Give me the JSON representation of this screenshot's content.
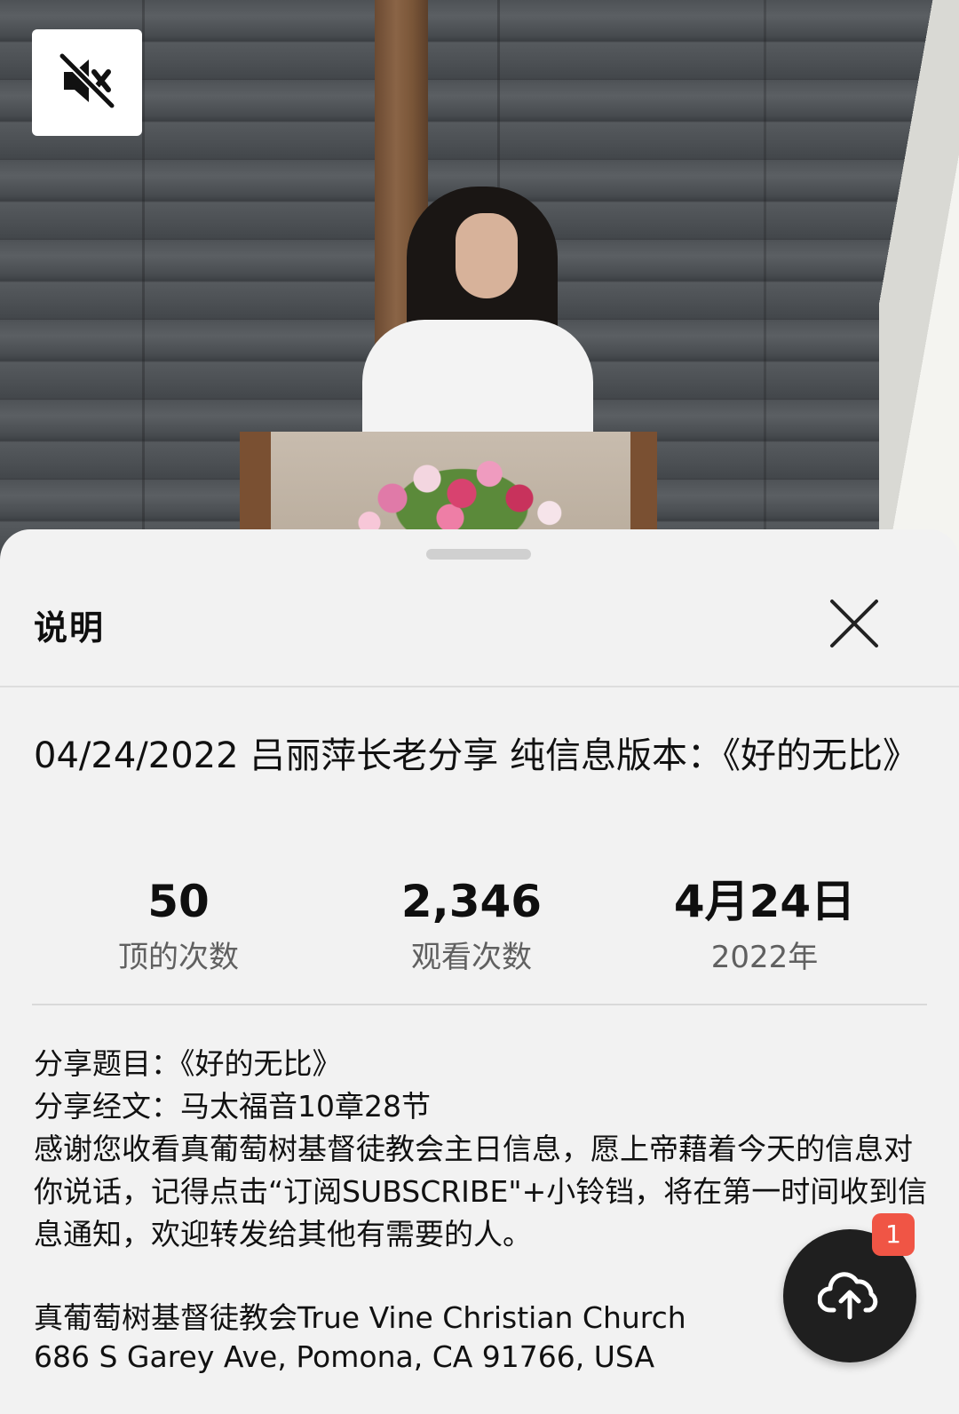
{
  "player": {
    "mute_icon": "volume-muted-icon"
  },
  "sheet": {
    "title": "说明",
    "close_icon": "close-icon",
    "video_title": "04/24/2022 吕丽萍长老分享 纯信息版本：《好的无比》",
    "stats": [
      {
        "value": "50",
        "label": "顶的次数"
      },
      {
        "value": "2,346",
        "label": "观看次数"
      },
      {
        "value": "4月24日",
        "label": "2022年"
      }
    ],
    "description": {
      "line1": "分享题目：《好的无比》",
      "line2": "分享经文：马太福音10章28节",
      "line3": "感谢您收看真葡萄树基督徒教会主日信息，愿上帝藉着今天的信息对你说话，记得点击“订阅SUBSCRIBE\"+小铃铛，将在第一时间收到信息通知，欢迎转发给其他有需要的人。",
      "church": "真葡萄树基督徒教会True Vine Christian Church",
      "address": "686 S Garey Ave, Pomona, CA 91766, USA"
    }
  },
  "fab": {
    "icon": "cloud-upload-icon",
    "badge": "1"
  }
}
